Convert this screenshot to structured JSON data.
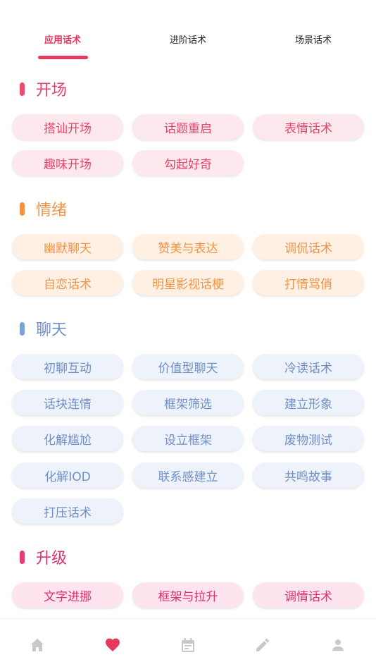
{
  "tabs": [
    {
      "label": "应用话术",
      "active": true
    },
    {
      "label": "进阶话术",
      "active": false
    },
    {
      "label": "场景话术",
      "active": false
    }
  ],
  "colors": {
    "accent": "#e6395f",
    "pink": "#e3456a",
    "orange": "#f19448",
    "blue": "#6f8fc6",
    "magenta": "#e0306e",
    "nav_icon": "#c8c8c8"
  },
  "sections": [
    {
      "title": "开场",
      "items": [
        "搭讪开场",
        "话题重启",
        "表情话术",
        "趣味开场",
        "勾起好奇"
      ]
    },
    {
      "title": "情绪",
      "items": [
        "幽默聊天",
        "赞美与表达",
        "调侃话术",
        "自恋话术",
        "明星影视话梗",
        "打情骂俏"
      ]
    },
    {
      "title": "聊天",
      "items": [
        "初聊互动",
        "价值型聊天",
        "冷读话术",
        "话块连情",
        "框架筛选",
        "建立形象",
        "化解尴尬",
        "设立框架",
        "废物测试",
        "化解IOD",
        "联系感建立",
        "共鸣故事",
        "打压话术"
      ]
    },
    {
      "title": "升级",
      "items": [
        "文字进挪",
        "框架与拉升",
        "调情话术"
      ]
    }
  ],
  "bottom_nav": [
    {
      "icon": "home-icon",
      "active": false
    },
    {
      "icon": "heart-icon",
      "active": true
    },
    {
      "icon": "calendar-icon",
      "active": false
    },
    {
      "icon": "pencil-icon",
      "active": false
    },
    {
      "icon": "person-icon",
      "active": false
    }
  ]
}
